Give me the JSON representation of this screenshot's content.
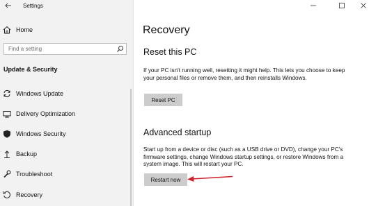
{
  "window": {
    "app_title": "Settings",
    "controls": {
      "minimize_icon": "minimize-icon",
      "maximize_icon": "maximize-icon",
      "close_icon": "close-icon"
    }
  },
  "sidebar": {
    "home_label": "Home",
    "search_placeholder": "Find a setting",
    "section_heading": "Update & Security",
    "items": [
      {
        "label": "Windows Update",
        "icon": "sync-icon"
      },
      {
        "label": "Delivery Optimization",
        "icon": "delivery-icon"
      },
      {
        "label": "Windows Security",
        "icon": "shield-icon"
      },
      {
        "label": "Backup",
        "icon": "backup-icon"
      },
      {
        "label": "Troubleshoot",
        "icon": "wrench-icon"
      },
      {
        "label": "Recovery",
        "icon": "recovery-icon"
      }
    ]
  },
  "main": {
    "page_title": "Recovery",
    "reset": {
      "heading": "Reset this PC",
      "description": "If your PC isn't running well, resetting it might help. This lets you choose to keep your personal files or remove them, and then reinstalls Windows.",
      "button_label": "Reset PC"
    },
    "advanced": {
      "heading": "Advanced startup",
      "description": "Start up from a device or disc (such as a USB drive or DVD), change your PC's firmware settings, change Windows startup settings, or restore Windows from a system image. This will restart your PC.",
      "button_label": "Restart now"
    }
  },
  "colors": {
    "sidebar_bg": "#f2f2f2",
    "button_bg": "#cccccc",
    "annotation_arrow": "#d0202a"
  }
}
